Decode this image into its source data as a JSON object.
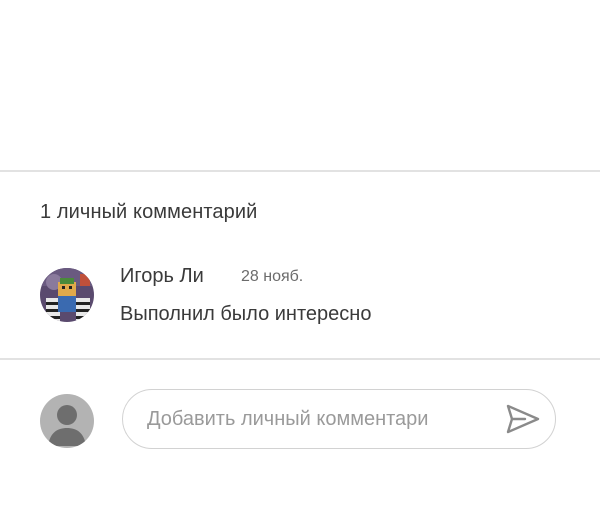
{
  "comments": {
    "count_label": "1 личный комментарий",
    "items": [
      {
        "author": "Игорь Ли",
        "date": "28 нояб.",
        "text": "Выполнил было интересно",
        "avatar_icon": "user-photo-avatar"
      }
    ]
  },
  "composer": {
    "placeholder": "Добавить личный комментари",
    "value": "",
    "user_avatar_icon": "default-person-icon",
    "send_icon": "send-icon"
  },
  "colors": {
    "text": "#3a3a3a",
    "muted": "#6b6b6b",
    "placeholder": "#9a9a9a",
    "divider": "#e2e2e2",
    "avatar_gray": "#b3b3b3"
  }
}
